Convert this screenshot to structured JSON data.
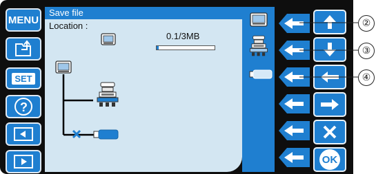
{
  "sidebar": {
    "menu_label": "MENU",
    "set_label": "SET",
    "help_glyph": "?",
    "items": [
      "folder-export-icon",
      "set-button",
      "help-icon",
      "screen-left-icon",
      "screen-right-icon"
    ]
  },
  "panel": {
    "title": "Save file",
    "location_label": "Location :",
    "capacity": "0.1/3MB"
  },
  "nav": {
    "ok_label": "OK",
    "buttons": [
      "up-arrow-icon",
      "down-arrow-icon",
      "left-arrow-icon",
      "right-arrow-icon",
      "close-icon",
      "ok-button"
    ]
  },
  "callouts": [
    "②",
    "③",
    "④"
  ],
  "colors": {
    "accent": "#1f7fd0",
    "panel_bg": "#d3e6f2",
    "frame": "#0e0e0e",
    "usb": "#1f7fd0",
    "error_x": "#1f7fd0"
  }
}
